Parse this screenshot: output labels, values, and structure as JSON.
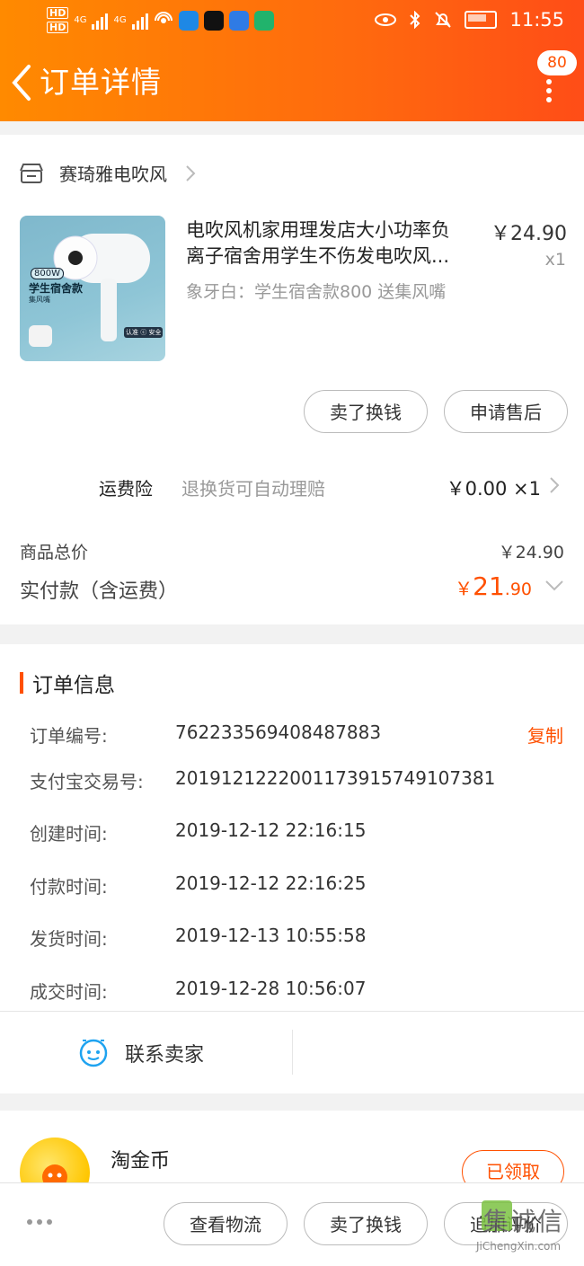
{
  "status_bar": {
    "time": "11:55",
    "network_1": "4G",
    "network_2": "4G",
    "hd_1": "HD",
    "hd_2": "HD"
  },
  "header": {
    "title": "订单详情",
    "message_count": "80"
  },
  "shop": {
    "name": "赛琦雅电吹风"
  },
  "product": {
    "title_line1": "电吹风机家用理发店大小功率负",
    "title_line2": "离子宿舍用学生不伤发电吹风...",
    "price": "￥24.90",
    "quantity": "x1",
    "sku": "象牙白：学生宿舍款800 送集风嘴",
    "image_text": {
      "power": "800W",
      "line": "学生宿舍款",
      "sub": "集风嘴",
      "badge": "认准 ⓒ 安全"
    }
  },
  "item_actions": {
    "sell": "卖了换钱",
    "aftersale": "申请售后"
  },
  "insurance": {
    "label": "运费险",
    "desc": "退换货可自动理赔",
    "value": "￥0.00 ×1"
  },
  "totals": {
    "goods_label": "商品总价",
    "goods_value": "￥24.90",
    "paid_label": "实付款（含运费）",
    "paid_currency": "￥",
    "paid_int": "21",
    "paid_dec": ".90"
  },
  "order_info": {
    "heading": "订单信息",
    "copy": "复制",
    "rows": [
      {
        "label": "订单编号:",
        "value": "762233569408487883"
      },
      {
        "label": "支付宝交易号:",
        "value": "2019121222001173915749107381"
      },
      {
        "label": "创建时间:",
        "value": "2019-12-12 22:16:15"
      },
      {
        "label": "付款时间:",
        "value": "2019-12-12 22:16:25"
      },
      {
        "label": "发货时间:",
        "value": "2019-12-13 10:55:58"
      },
      {
        "label": "成交时间:",
        "value": "2019-12-28 10:56:07"
      }
    ],
    "contact": "联系卖家"
  },
  "coins": {
    "label": "淘金币",
    "button": "已领取"
  },
  "bottom_bar": {
    "logistics": "查看物流",
    "sell": "卖了换钱",
    "review": "追加评价"
  },
  "watermark": {
    "chars": "集诚信",
    "url": "JiChengXin.com"
  },
  "colors": {
    "accent": "#ff5000",
    "header_start": "#ff8a00",
    "header_end": "#ff4d17"
  }
}
